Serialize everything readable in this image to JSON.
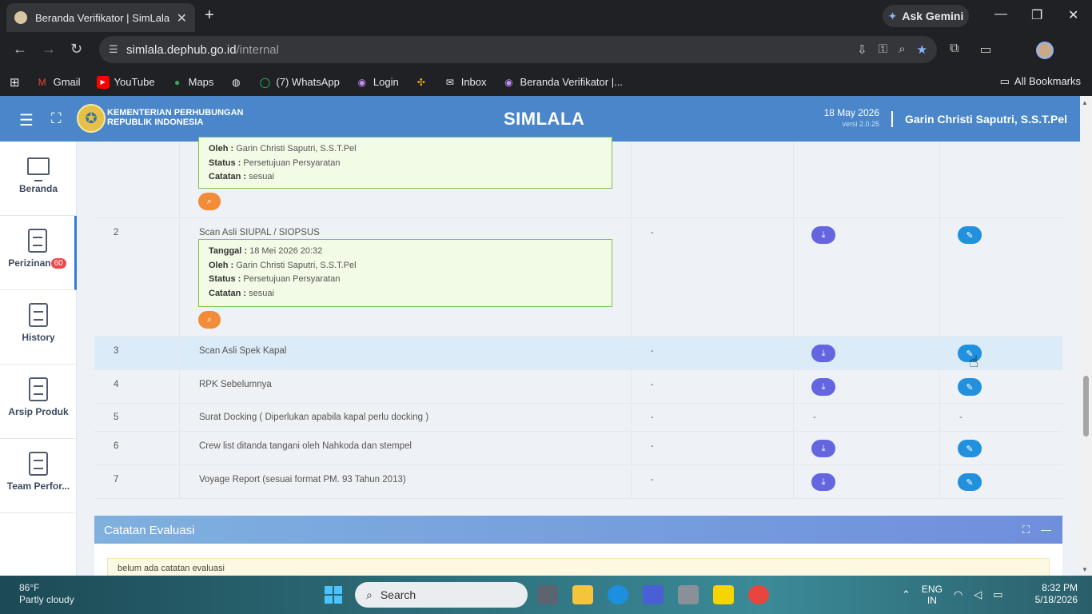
{
  "browser": {
    "tab_title": "Beranda Verifikator | SimLala",
    "ask_gemini": "Ask Gemini",
    "url_host": "simlala.dephub.go.id",
    "url_path": "/internal",
    "bookmarks": [
      "Gmail",
      "YouTube",
      "Maps",
      "(7) WhatsApp",
      "Login",
      "Inbox",
      "Beranda Verifikator |..."
    ],
    "all_bookmarks": "All Bookmarks"
  },
  "app": {
    "ministry_line1": "KEMENTERIAN PERHUBUNGAN",
    "ministry_line2": "REPUBLIK INDONESIA",
    "brand": "SIMLALA",
    "date": "18 May 2026",
    "version": "versi 2.0.25",
    "user": "Garin Christi Saputri, S.S.T.Pel"
  },
  "sidebar": {
    "items": [
      {
        "label": "Beranda"
      },
      {
        "label": "Perizinan",
        "badge": "60"
      },
      {
        "label": "History"
      },
      {
        "label": "Arsip Produk"
      },
      {
        "label": "Team Perfor..."
      }
    ]
  },
  "table": {
    "partial_note": {
      "oleh_label": "Oleh :",
      "oleh": "Garin Christi Saputri, S.S.T.Pel",
      "status_label": "Status :",
      "status": "Persetujuan Persyaratan",
      "catatan_label": "Catatan :",
      "catatan": "sesuai"
    },
    "rows": [
      {
        "no": "2",
        "name": "Scan Asli SIUPAL / SIOPSUS",
        "col3": "-",
        "note": {
          "tanggal_label": "Tanggal :",
          "tanggal": "18 Mei 2026 20:32",
          "oleh_label": "Oleh :",
          "oleh": "Garin Christi Saputri, S.S.T.Pel",
          "status_label": "Status :",
          "status": "Persetujuan Persyaratan",
          "catatan_label": "Catatan :",
          "catatan": "sesuai"
        }
      },
      {
        "no": "3",
        "name": "Scan Asli Spek Kapal",
        "col3": "-"
      },
      {
        "no": "4",
        "name": "RPK Sebelumnya",
        "col3": "-"
      },
      {
        "no": "5",
        "name": "Surat Docking ( Diperlukan apabila kapal perlu docking )",
        "col3": "-",
        "col4": "-",
        "col5": "-"
      },
      {
        "no": "6",
        "name": "Crew list ditanda tangani oleh Nahkoda dan stempel",
        "col3": "-"
      },
      {
        "no": "7",
        "name": "Voyage Report (sesuai format PM. 93 Tahun 2013)",
        "col3": "-"
      }
    ]
  },
  "evaluasi": {
    "title": "Catatan Evaluasi",
    "empty": "belum ada catatan evaluasi"
  },
  "taskbar": {
    "temp": "86°F",
    "weather": "Partly cloudy",
    "search": "Search",
    "lang1": "ENG",
    "lang2": "IN",
    "time": "8:32 PM",
    "date": "5/18/2026"
  }
}
